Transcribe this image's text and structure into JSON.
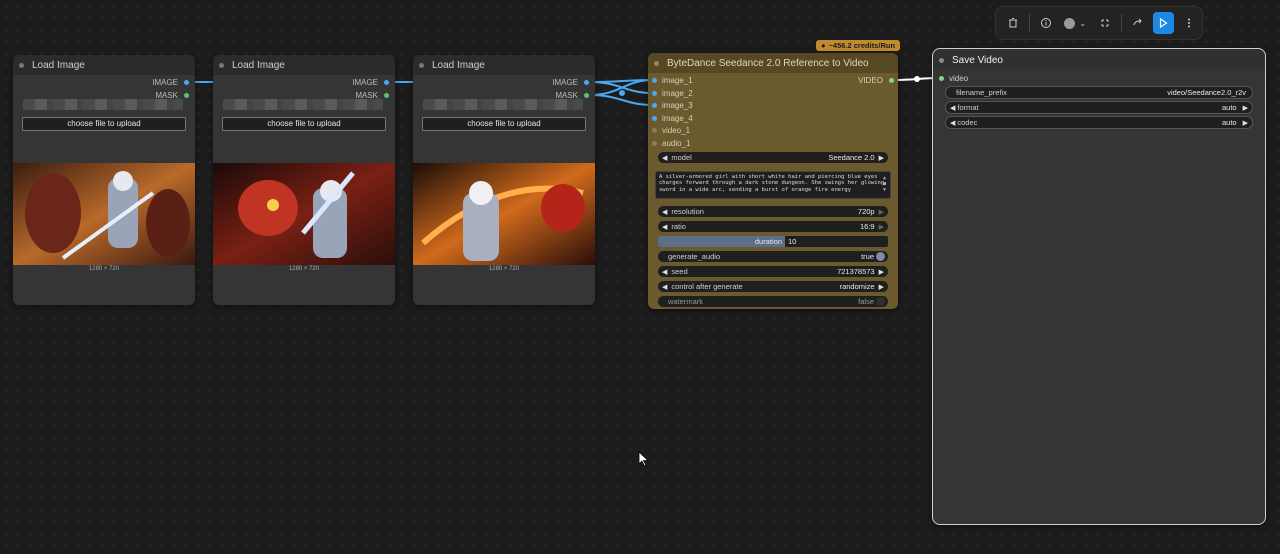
{
  "load_nodes": [
    {
      "title": "Load Image",
      "out_image": "IMAGE",
      "out_mask": "MASK",
      "upload_label": "choose file to upload",
      "dims": "1280 × 720"
    },
    {
      "title": "Load Image",
      "out_image": "IMAGE",
      "out_mask": "MASK",
      "upload_label": "choose file to upload",
      "dims": "1280 × 720"
    },
    {
      "title": "Load Image",
      "out_image": "IMAGE",
      "out_mask": "MASK",
      "upload_label": "choose file to upload",
      "dims": "1280 × 720"
    }
  ],
  "seedance": {
    "title": "ByteDance Seedance 2.0 Reference to Video",
    "credits": "~456.2 credits/Run",
    "output": "VIDEO",
    "inputs": [
      "image_1",
      "image_2",
      "image_3",
      "image_4",
      "video_1",
      "audio_1"
    ],
    "model": {
      "label": "model",
      "value": "Seedance 2.0"
    },
    "prompt": "A silver-armored girl with short white hair and piercing blue eyes charges forward through a dark stone dungeon. She swings her glowing sword in a wide arc, sending a burst of orange fire energy",
    "resolution": {
      "label": "resolution",
      "value": "720p"
    },
    "ratio": {
      "label": "ratio",
      "value": "16:9"
    },
    "duration": {
      "label": "duration",
      "value": "10",
      "fill": 0.55
    },
    "generate_audio": {
      "label": "generate_audio",
      "value": "true"
    },
    "seed": {
      "label": "seed",
      "value": "721378573"
    },
    "control_after_generate": {
      "label": "control after generate",
      "value": "randomize"
    },
    "watermark": {
      "label": "watermark",
      "value": "false"
    }
  },
  "save_video": {
    "title": "Save Video",
    "input": "video",
    "filename_prefix": {
      "label": "filename_prefix",
      "value": "video/Seedance2.0_r2v"
    },
    "format": {
      "label": "format",
      "value": "auto"
    },
    "codec": {
      "label": "codec",
      "value": "auto"
    }
  },
  "toolbar": {
    "icons": [
      "trash-icon",
      "info-icon",
      "color-picker-icon",
      "fit-view-icon",
      "redo-icon",
      "run-icon",
      "more-icon"
    ]
  },
  "colors": {
    "image_link": "#4aa8f0",
    "video_link": "#ffffff",
    "seedance_body": "#6b5a2e",
    "credits_badge": "#c08a2e",
    "run_button": "#1e88e5"
  }
}
